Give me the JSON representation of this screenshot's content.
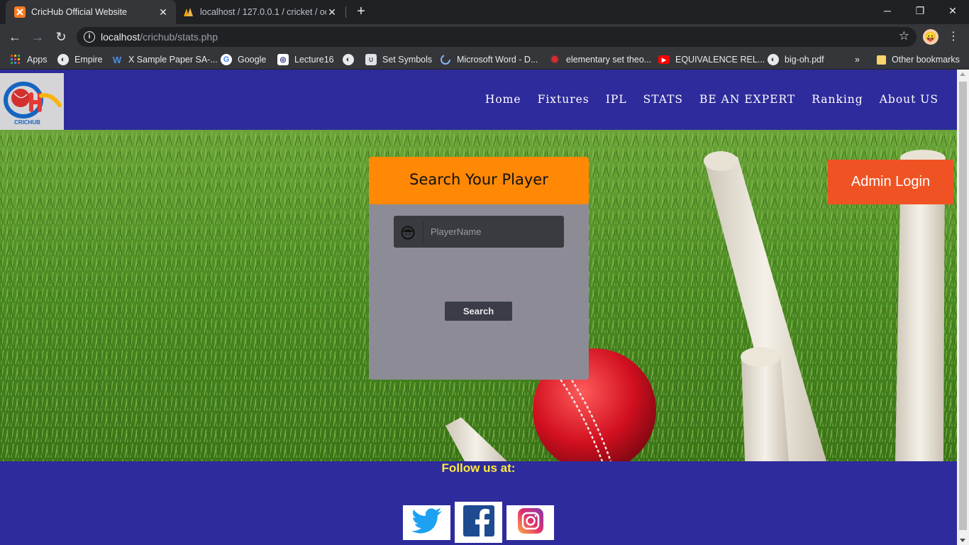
{
  "browser": {
    "tabs": [
      {
        "title": "CricHub Official Website",
        "favicon": "xampp-icon",
        "active": true
      },
      {
        "title": "localhost / 127.0.0.1 / cricket / oc",
        "favicon": "phpmyadmin-icon",
        "active": false
      }
    ],
    "url": {
      "host": "localhost",
      "path": "/crichub/stats.php"
    },
    "bookmarks": [
      {
        "label": "Apps",
        "icon": "apps-grid-icon"
      },
      {
        "label": "Empire",
        "icon": "globe-icon"
      },
      {
        "label": "X Sample Paper SA-...",
        "icon": "w-logo-icon"
      },
      {
        "label": "Google",
        "icon": "google-icon"
      },
      {
        "label": "Lecture16",
        "icon": "lecture-icon"
      },
      {
        "label": "",
        "icon": "globe-icon"
      },
      {
        "label": "Set Symbols",
        "icon": "set-symbols-icon"
      },
      {
        "label": "Microsoft Word - D...",
        "icon": "loading-icon"
      },
      {
        "label": "elementary set theo...",
        "icon": "red-gear-icon"
      },
      {
        "label": "EQUIVALENCE REL...",
        "icon": "youtube-icon"
      },
      {
        "label": "big-oh.pdf",
        "icon": "globe-icon"
      }
    ],
    "bookmarks_overflow": "»",
    "other_bookmarks": "Other bookmarks"
  },
  "site": {
    "logo_text": "CRICHUB",
    "nav": [
      "Home",
      "Fixtures",
      "IPL",
      "STATS",
      "BE AN EXPERT",
      "Ranking",
      "About US"
    ],
    "search_card": {
      "title": "Search Your Player",
      "placeholder": "PlayerName",
      "value": "",
      "button": "Search"
    },
    "admin_login": "Admin Login",
    "footer": {
      "follow": "Follow us at:",
      "social": [
        "twitter-icon",
        "facebook-icon",
        "instagram-icon"
      ]
    }
  },
  "colors": {
    "header_bg": "#2e2b9c",
    "search_header": "#ff8805",
    "admin_button": "#f05323",
    "follow_text": "#ffeb3b"
  }
}
